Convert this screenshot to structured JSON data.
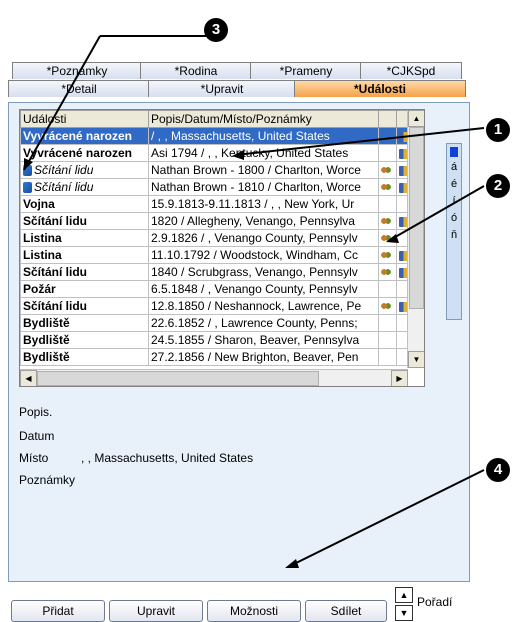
{
  "tabs": {
    "row1": [
      "*Poznámky",
      "*Rodina",
      "*Prameny",
      "*CJKSpd"
    ],
    "row2": [
      "*Detail",
      "*Upravit",
      "*Události"
    ]
  },
  "grid": {
    "headers": [
      "Události",
      "Popis/Datum/Místo/Poznámky"
    ],
    "rows": [
      {
        "event": "Vyvrácené narozen",
        "detail": "/ , , Massachusetts, United States",
        "people": false,
        "book": true,
        "selected": true
      },
      {
        "event": "Vyvrácené narozen",
        "detail": "Asi 1794 / , , Kentucky, United States",
        "people": false,
        "book": true
      },
      {
        "event": "Sčítání lidu",
        "detail": "Nathan Brown - 1800 / Charlton, Worce",
        "people": true,
        "book": true,
        "italic": true
      },
      {
        "event": "Sčítání lidu",
        "detail": "Nathan Brown - 1810 / Charlton, Worce",
        "people": true,
        "book": true,
        "italic": true
      },
      {
        "event": "Vojna",
        "detail": "15.9.1813-9.11.1813 / , , New York, Ur",
        "people": false,
        "book": false
      },
      {
        "event": "Sčítání lidu",
        "detail": "1820 / Allegheny, Venango, Pennsylva",
        "people": true,
        "book": true
      },
      {
        "event": "Listina",
        "detail": "2.9.1826 / , Venango County, Pennsylv",
        "people": true,
        "book": false
      },
      {
        "event": "Listina",
        "detail": "11.10.1792 / Woodstock, Windham, Cc",
        "people": true,
        "book": true
      },
      {
        "event": "Sčítání lidu",
        "detail": "1840 / Scrubgrass, Venango, Pennsylv",
        "people": true,
        "book": true
      },
      {
        "event": "Požár",
        "detail": "6.5.1848 / , Venango County, Pennsylv",
        "people": false,
        "book": false
      },
      {
        "event": "Sčítání lidu",
        "detail": "12.8.1850 / Neshannock, Lawrence, Pe",
        "people": true,
        "book": true
      },
      {
        "event": "Bydliště",
        "detail": "22.6.1852 / , Lawrence County, Penns;",
        "people": false,
        "book": false
      },
      {
        "event": "Bydliště",
        "detail": "24.5.1855 / Sharon, Beaver, Pennsylva",
        "people": false,
        "book": false
      },
      {
        "event": "Bydliště",
        "detail": "27.2.1856 / New Brighton, Beaver, Pen",
        "people": false,
        "book": false
      }
    ]
  },
  "side_letters": [
    "á",
    "é",
    "í",
    "ó",
    "ň"
  ],
  "details": {
    "popis_label": "Popis.",
    "datum_label": "Datum",
    "misto_label": "Místo",
    "misto_value": ", , Massachusetts, United States",
    "poznamky_label": "Poznámky"
  },
  "buttons": {
    "pridat": "Přidat",
    "upravit": "Upravit",
    "moznosti": "Možnosti",
    "sdilet": "Sdílet",
    "poradi": "Pořadí"
  },
  "callouts": [
    "1",
    "2",
    "3",
    "4"
  ]
}
